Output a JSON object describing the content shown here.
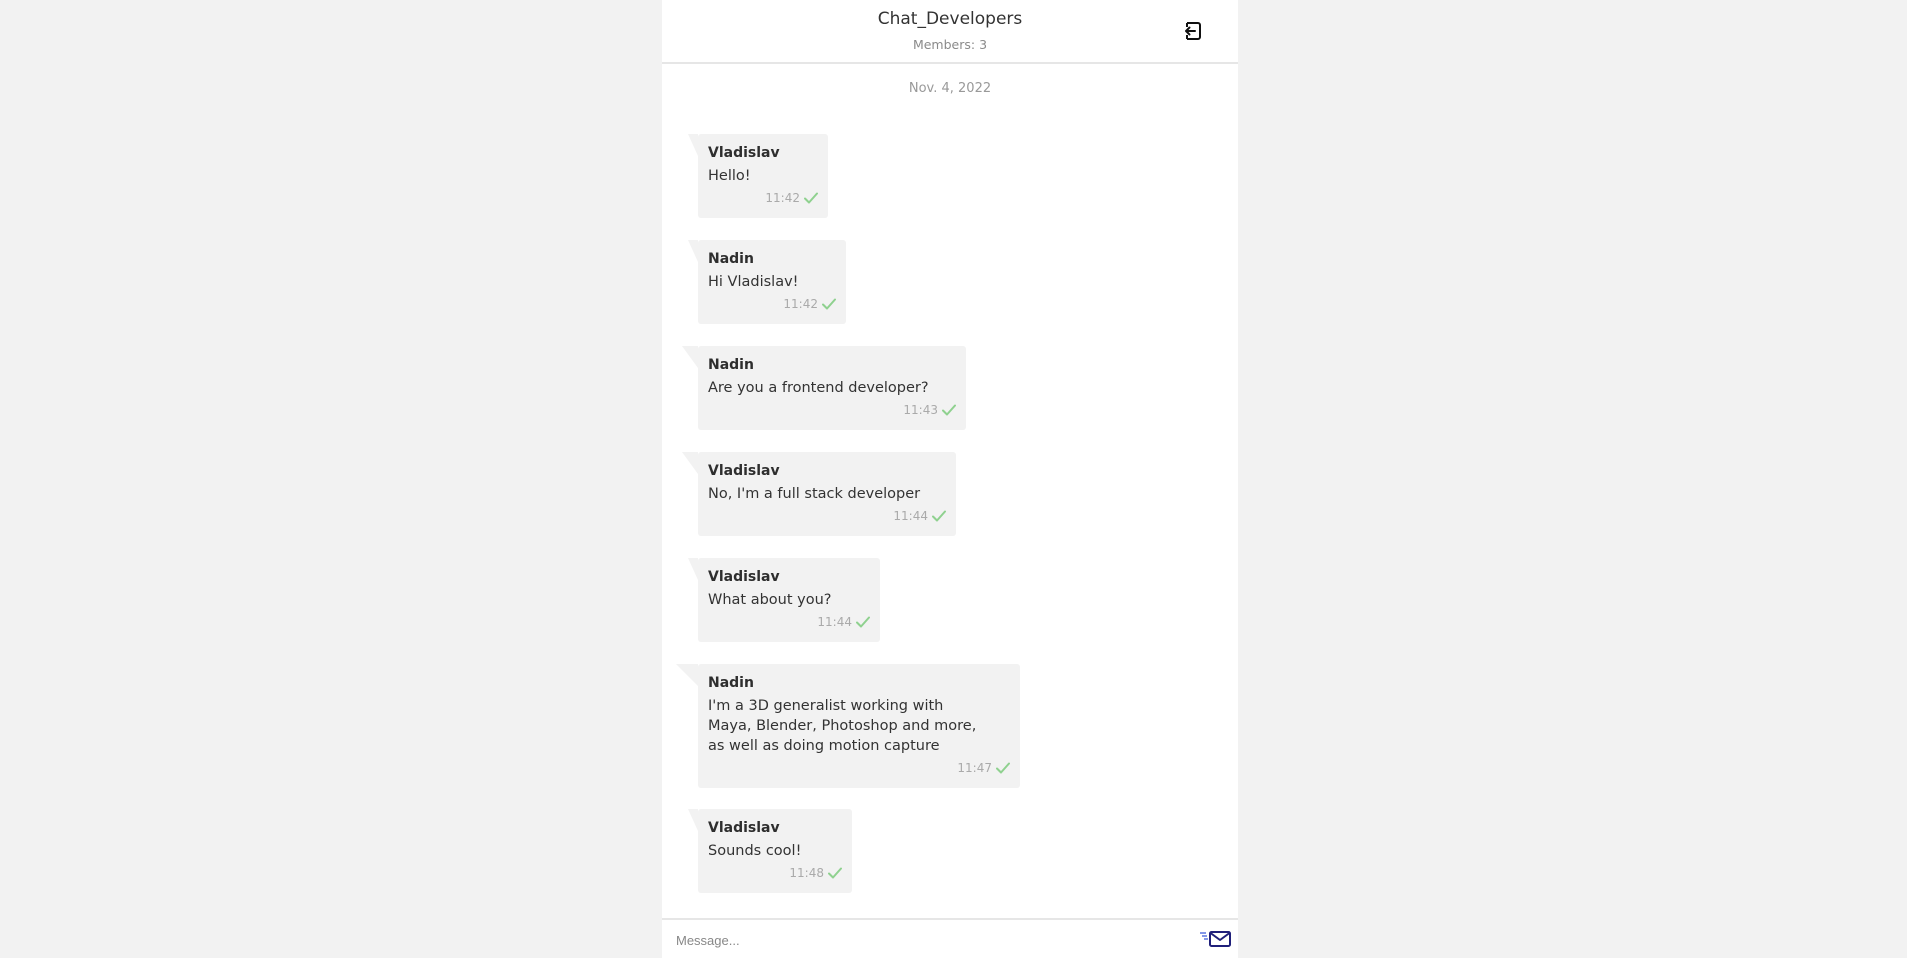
{
  "header": {
    "title": "Chat_Developers",
    "members": "Members: 3",
    "exit_icon": "exit-arrow-icon"
  },
  "date": "Nov. 4, 2022",
  "messages": [
    {
      "sender": "Vladislav",
      "text": "Hello!",
      "time": "11:42"
    },
    {
      "sender": "Nadin",
      "text": "Hi Vladislav!",
      "time": "11:42"
    },
    {
      "sender": "Nadin",
      "text": "Are you a frontend developer?",
      "time": "11:43"
    },
    {
      "sender": "Vladislav",
      "text": "No, I'm a full stack developer",
      "time": "11:44"
    },
    {
      "sender": "Vladislav",
      "text": "What about you?",
      "time": "11:44"
    },
    {
      "sender": "Nadin",
      "text": "I'm a 3D generalist working with\nMaya, Blender, Photoshop and more,\nas well as doing motion capture",
      "time": "11:47"
    },
    {
      "sender": "Vladislav",
      "text": "Sounds cool!",
      "time": "11:48"
    }
  ],
  "composer": {
    "placeholder": "Message...",
    "send_icon": "send-mail-icon"
  },
  "colors": {
    "check": "#8fd18f",
    "send_icon": "#1f1f7a"
  }
}
